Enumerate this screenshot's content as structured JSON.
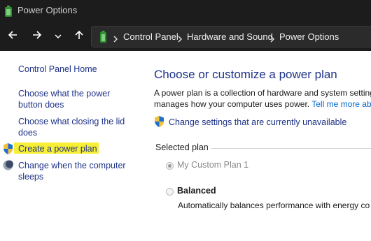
{
  "window": {
    "title": "Power Options"
  },
  "nav": {
    "breadcrumb": [
      "Control Panel",
      "Hardware and Sound",
      "Power Options"
    ]
  },
  "sidebar": {
    "home": "Control Panel Home",
    "items": [
      {
        "label_line1": "Choose what the power",
        "label_line2": "button does"
      },
      {
        "label_line1": "Choose what closing the lid",
        "label_line2": "does"
      },
      {
        "label_line1": "Create a power plan"
      },
      {
        "label_line1": "Change when the computer",
        "label_line2": "sleeps"
      }
    ]
  },
  "main": {
    "title": "Choose or customize a power plan",
    "description_line1": "A power plan is a collection of hardware and system settings",
    "description_line2_prefix": "manages how your computer uses power.",
    "description_link": "Tell me more about",
    "change_settings_link": "Change settings that are currently unavailable",
    "group_label": "Selected plan",
    "plans": [
      {
        "name": "My Custom Plan 1",
        "selected": true,
        "description": ""
      },
      {
        "name": "Balanced",
        "selected": false,
        "description": "Automatically balances performance with energy co"
      }
    ]
  },
  "colors": {
    "highlight": "#f7ef35",
    "link": "#1e3287"
  }
}
